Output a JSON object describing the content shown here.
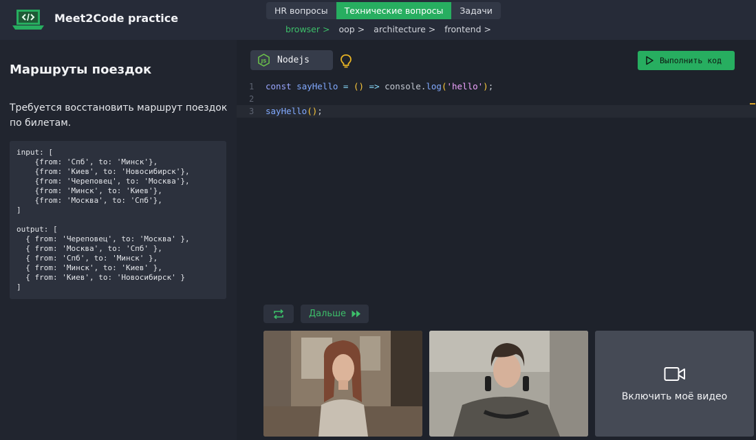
{
  "app": {
    "title": "Meet2Code practice"
  },
  "tabs": [
    {
      "label": "HR вопросы",
      "active": false
    },
    {
      "label": "Технические вопросы",
      "active": true
    },
    {
      "label": "Задачи",
      "active": false
    }
  ],
  "breadcrumb": [
    "browser >",
    "oop >",
    "architecture >",
    "frontend >"
  ],
  "task": {
    "title": "Маршруты поездок",
    "description": "Требуется восстановить маршрут поездок по билетам.",
    "example": "input: [\n    {from: 'Спб', to: 'Минск'},\n    {from: 'Киев', to: 'Новосибирск'},\n    {from: 'Череповец', to: 'Москва'},\n    {from: 'Минск', to: 'Киев'},\n    {from: 'Москва', to: 'Спб'},\n]\n\noutput: [\n  { from: 'Череповец', to: 'Москва' },\n  { from: 'Москва', to: 'Спб' },\n  { from: 'Спб', to: 'Минск' },\n  { from: 'Минск', to: 'Киев' },\n  { from: 'Киев', to: 'Новосибирск' }\n]"
  },
  "editor": {
    "language": "Nodejs",
    "run_label": "Выполнить код",
    "line_numbers": [
      "1",
      "2",
      "3"
    ],
    "line1": {
      "kw": "const",
      "fn": "sayHello",
      "eq": " = ",
      "paren": "()",
      "arrow": " => ",
      "obj": "console.",
      "method": "log",
      "open": "(",
      "str": "'hello'",
      "close": ")",
      "semi": ";"
    },
    "line3": {
      "fn": "sayHello",
      "paren": "()",
      "semi": ";"
    }
  },
  "controls": {
    "next_label": "Дальше"
  },
  "video": {
    "enable_label": "Включить моё видео"
  },
  "colors": {
    "accent": "#27ae60",
    "background": "#262b38",
    "panel": "#21252f",
    "editor": "#1e222b"
  }
}
